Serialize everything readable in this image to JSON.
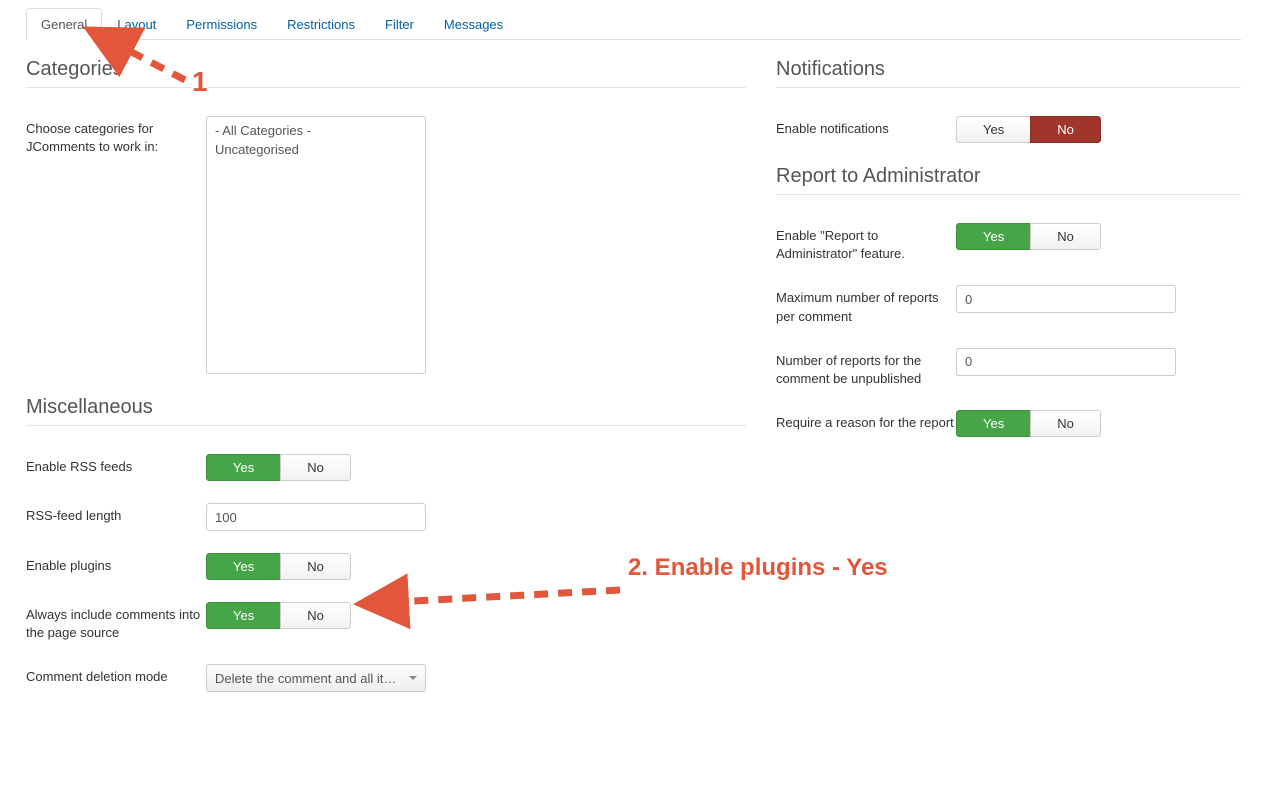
{
  "tabs": {
    "general": "General",
    "layout": "Layout",
    "permissions": "Permissions",
    "restrictions": "Restrictions",
    "filter": "Filter",
    "messages": "Messages"
  },
  "sections": {
    "categories": "Categories",
    "miscellaneous": "Miscellaneous",
    "notifications": "Notifications",
    "report": "Report to Administrator"
  },
  "labels": {
    "choose_categories": "Choose categories for JComments to work in:",
    "enable_rss": "Enable RSS feeds",
    "rss_length": "RSS-feed length",
    "enable_plugins": "Enable plugins",
    "always_include": "Always include comments into the page source",
    "deletion_mode": "Comment deletion mode",
    "enable_notifications": "Enable notifications",
    "enable_report": "Enable \"Report to Administrator\" feature.",
    "max_reports": "Maximum number of reports per comment",
    "reports_unpub": "Number of reports for the comment be unpublished",
    "require_reason": "Require a reason for the report"
  },
  "options": {
    "yes": "Yes",
    "no": "No"
  },
  "category_options": {
    "all": " - All Categories - ",
    "uncat": "Uncategorised"
  },
  "values": {
    "rss_length": "100",
    "max_reports": "0",
    "reports_unpub": "0",
    "deletion_mode": "Delete the comment and all it…"
  },
  "annotations": {
    "step1": "1",
    "step2": "2. Enable plugins -  Yes"
  }
}
